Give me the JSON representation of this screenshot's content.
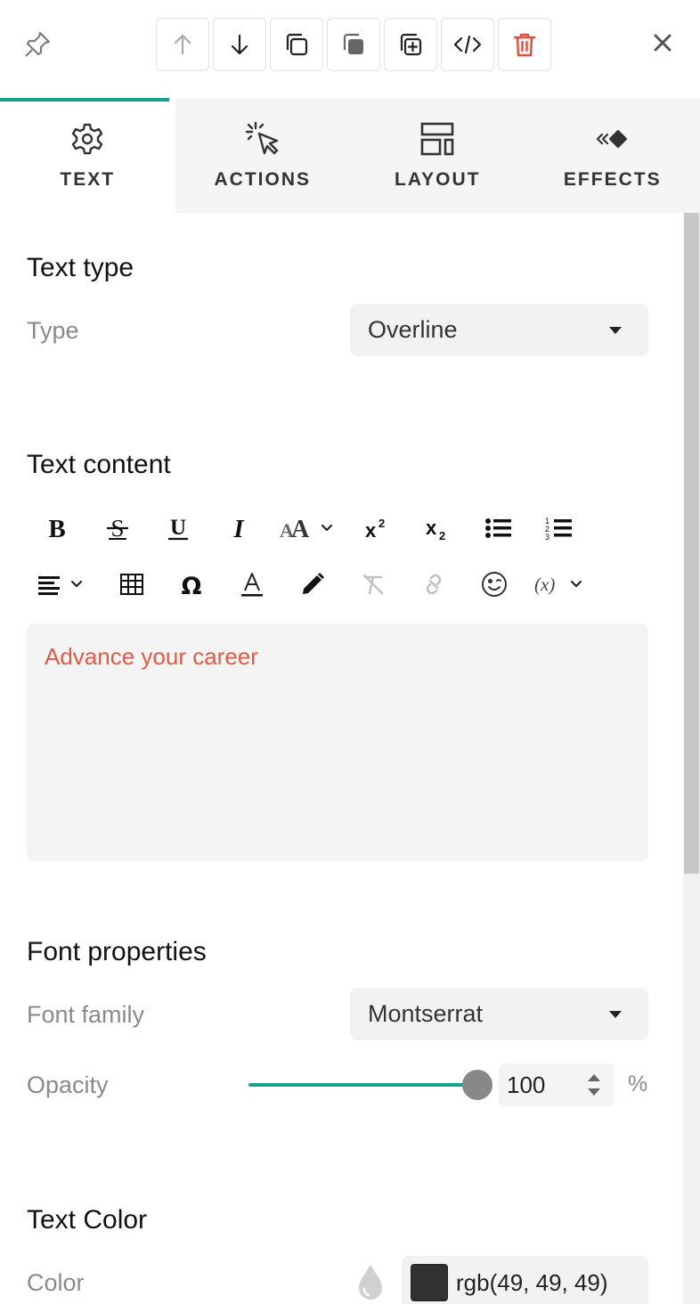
{
  "toolbar": {
    "buttons": [
      {
        "name": "move-up",
        "icon": "arrow-up-icon"
      },
      {
        "name": "move-down",
        "icon": "arrow-down-icon"
      },
      {
        "name": "duplicate",
        "icon": "copy-icon"
      },
      {
        "name": "copy-style",
        "icon": "copy-filled-icon"
      },
      {
        "name": "add",
        "icon": "add-copy-icon"
      },
      {
        "name": "code",
        "icon": "code-icon"
      },
      {
        "name": "delete",
        "icon": "trash-icon",
        "color": "#e64a3b"
      }
    ]
  },
  "tabs": [
    {
      "label": "TEXT",
      "icon": "gear-icon",
      "active": true
    },
    {
      "label": "ACTIONS",
      "icon": "cursor-click-icon",
      "active": false
    },
    {
      "label": "LAYOUT",
      "icon": "layout-icon",
      "active": false
    },
    {
      "label": "EFFECTS",
      "icon": "effects-icon",
      "active": false
    }
  ],
  "accent_color": "#12a191",
  "text_type": {
    "title": "Text type",
    "type_label": "Type",
    "type_value": "Overline"
  },
  "text_content": {
    "title": "Text content",
    "value": "Advance your career",
    "text_color": "#e25a4a"
  },
  "font_properties": {
    "title": "Font properties",
    "family_label": "Font family",
    "family_value": "Montserrat",
    "opacity_label": "Opacity",
    "opacity_value": "100",
    "opacity_unit": "%",
    "opacity_fraction": 1.0
  },
  "text_color": {
    "title": "Text Color",
    "color_label": "Color",
    "color_value": "rgb(49, 49, 49)",
    "swatch": "#313131"
  }
}
